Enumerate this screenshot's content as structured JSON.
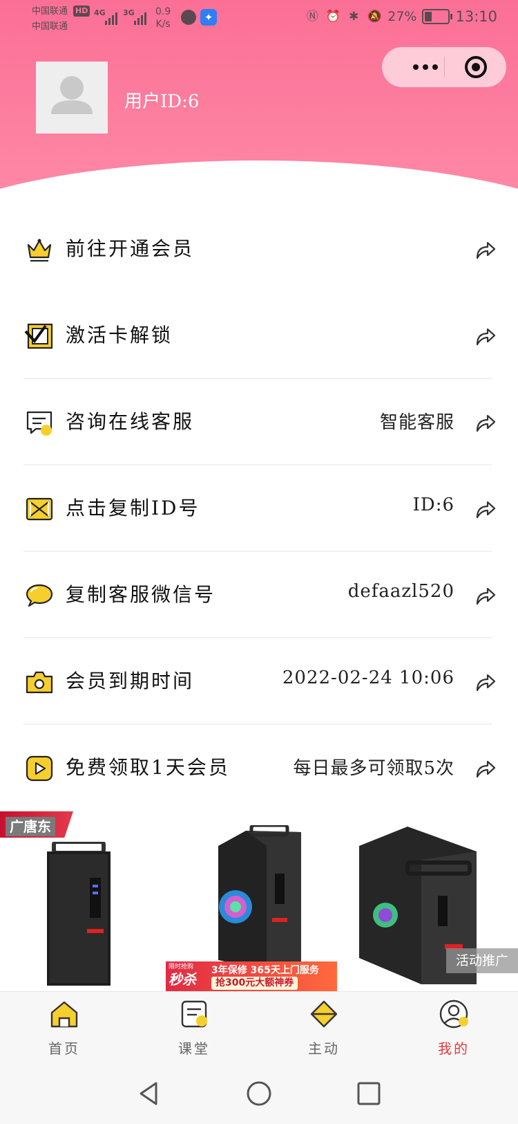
{
  "status_bar": {
    "carrier_1": "中国联通",
    "carrier_2": "中国联通",
    "hd": "HD",
    "signal_1": "4G",
    "signal_2": "3G",
    "speed_value": "0.9",
    "speed_unit": "K/s",
    "battery": "27%",
    "time": "13:10"
  },
  "header": {
    "user_id": "用户ID:6"
  },
  "menu": {
    "items": [
      {
        "label": "前往开通会员",
        "value": "",
        "icon": "crown-icon"
      },
      {
        "label": "激活卡解锁",
        "value": "",
        "icon": "checkbox-card-icon"
      },
      {
        "label": "咨询在线客服",
        "value": "智能客服",
        "icon": "chat-icon"
      },
      {
        "label": "点击复制ID号",
        "value": "ID:6",
        "icon": "ribbon-icon"
      },
      {
        "label": "复制客服微信号",
        "value": "defaazl520",
        "icon": "speech-bubble-icon"
      },
      {
        "label": "会员到期时间",
        "value": "2022-02-24  10:06",
        "icon": "camera-icon"
      },
      {
        "label": "免费领取1天会员",
        "value": "每日最多可领取5次",
        "icon": "play-icon"
      }
    ]
  },
  "ad": {
    "brand": "广唐东",
    "promo_small": "限时抢购",
    "promo_big": "秒杀",
    "promo_line1": "3年保修 365天上门服务",
    "promo_line2": "抢300元大额神券",
    "tag": "活动推广"
  },
  "tabbar": {
    "items": [
      {
        "label": "首页",
        "icon": "home-icon",
        "active": false
      },
      {
        "label": "课堂",
        "icon": "document-icon",
        "active": false
      },
      {
        "label": "主动",
        "icon": "diamond-icon",
        "active": false
      },
      {
        "label": "我的",
        "icon": "profile-icon",
        "active": true
      }
    ]
  },
  "colors": {
    "header_pink": "#fb6f96",
    "accent_yellow": "#f7cf2c",
    "active_tab": "#e03c3c"
  }
}
